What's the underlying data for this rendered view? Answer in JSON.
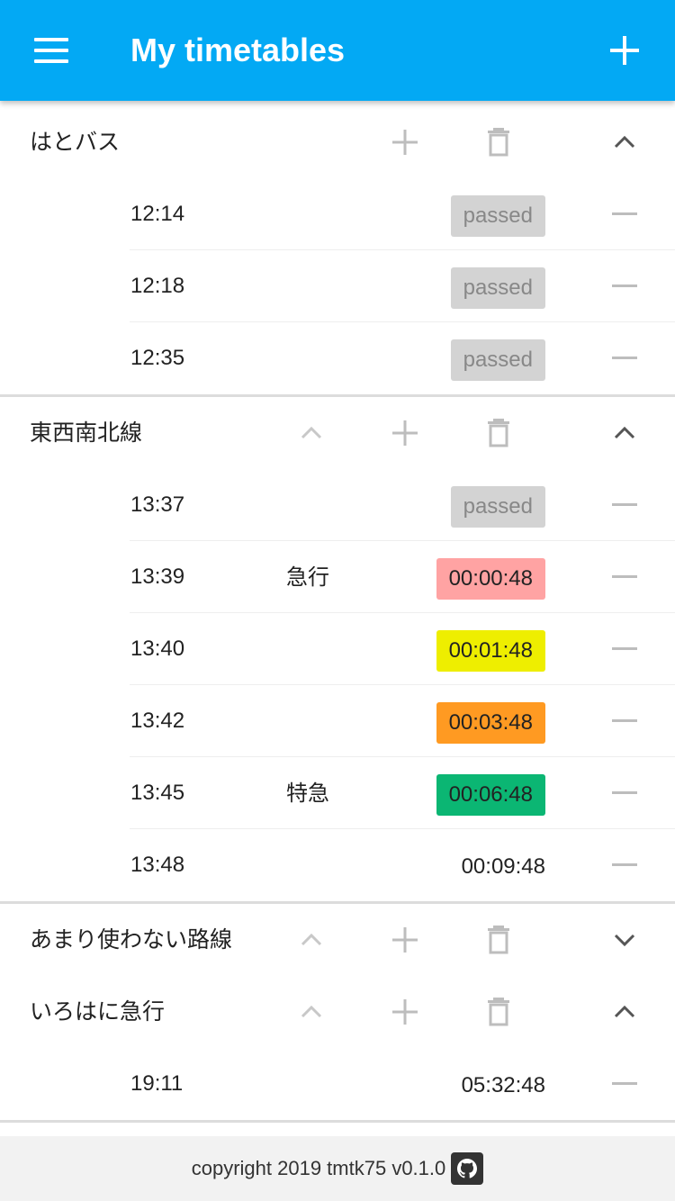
{
  "appbar": {
    "title": "My timetables"
  },
  "groups": [
    {
      "name": "はとバス",
      "has_up": false,
      "expanded": true,
      "rows": [
        {
          "time": "12:14",
          "type": "",
          "remaining": "passed",
          "status": "passed"
        },
        {
          "time": "12:18",
          "type": "",
          "remaining": "passed",
          "status": "passed"
        },
        {
          "time": "12:35",
          "type": "",
          "remaining": "passed",
          "status": "passed"
        }
      ]
    },
    {
      "name": "東西南北線",
      "has_up": true,
      "expanded": true,
      "rows": [
        {
          "time": "13:37",
          "type": "",
          "remaining": "passed",
          "status": "passed"
        },
        {
          "time": "13:39",
          "type": "急行",
          "remaining": "00:00:48",
          "status": "red"
        },
        {
          "time": "13:40",
          "type": "",
          "remaining": "00:01:48",
          "status": "yellow"
        },
        {
          "time": "13:42",
          "type": "",
          "remaining": "00:03:48",
          "status": "orange"
        },
        {
          "time": "13:45",
          "type": "特急",
          "remaining": "00:06:48",
          "status": "green"
        },
        {
          "time": "13:48",
          "type": "",
          "remaining": "00:09:48",
          "status": "plain"
        }
      ]
    },
    {
      "name": "あまり使わない路線",
      "has_up": true,
      "expanded": false,
      "rows": []
    },
    {
      "name": "いろはに急行",
      "has_up": true,
      "expanded": true,
      "rows": [
        {
          "time": "19:11",
          "type": "",
          "remaining": "05:32:48",
          "status": "plain"
        }
      ]
    }
  ],
  "footer": {
    "text": "copyright 2019 tmtk75 v0.1.0"
  },
  "icons": {
    "menu": "menu-icon",
    "add": "add-icon",
    "move_up": "chevron-up-icon",
    "delete": "trash-icon",
    "collapse": "chevron-up-icon",
    "expand": "chevron-down-icon",
    "remove": "minus-icon",
    "github": "github-icon"
  },
  "colors": {
    "appbar": "#03a9f4",
    "passed": "#d3d3d3",
    "red": "#ffa3a3",
    "yellow": "#eeee00",
    "orange": "#ff9a22",
    "green": "#0bb673"
  }
}
